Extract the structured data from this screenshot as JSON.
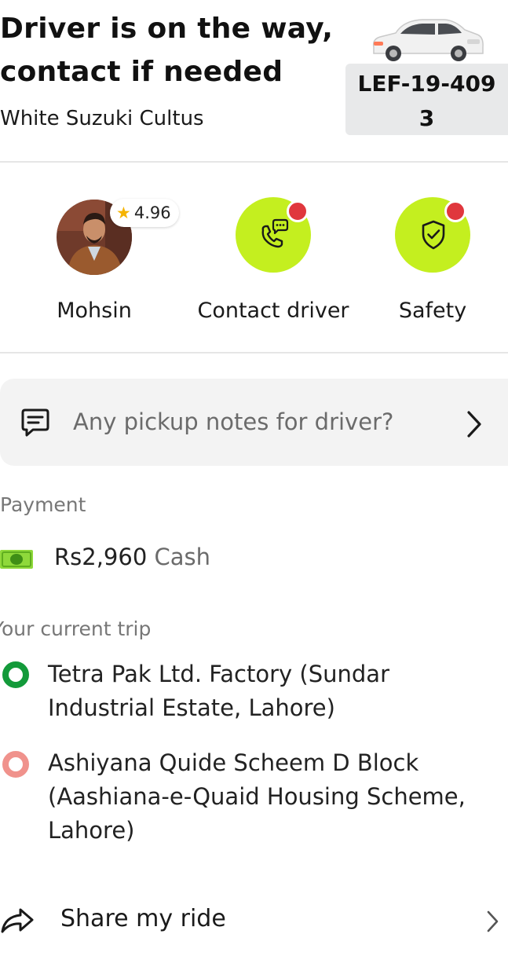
{
  "header": {
    "title_line1": "Driver is on the way,",
    "title_line2": "contact if needed",
    "vehicle": "White Suzuki Cultus",
    "plate_line1": "LEF-19-409",
    "plate_line2": "3",
    "icon": "car-icon"
  },
  "driver": {
    "name": "Mohsin",
    "rating": "4.96",
    "avatar_icon": "driver-avatar",
    "rating_icon": "star-icon"
  },
  "actions": [
    {
      "label": "Contact driver",
      "icon": "phone-chat-icon",
      "has_notification": true
    },
    {
      "label": "Safety",
      "icon": "shield-check-icon",
      "has_notification": true
    }
  ],
  "notes": {
    "placeholder": "Any pickup notes for driver?",
    "icon": "message-icon",
    "chevron_icon": "chevron-right-icon"
  },
  "payment": {
    "section_label": "Payment",
    "amount": "Rs2,960",
    "method": "Cash",
    "icon": "cash-icon"
  },
  "trip": {
    "section_label": "Your current trip",
    "pickup": {
      "line1": "Tetra Pak Ltd. Factory (Sundar",
      "line2": "Industrial Estate, Lahore)"
    },
    "dropoff": {
      "line1": "Ashiyana Quide Scheem D Block",
      "line2": "(Aashiana-e-Quaid Housing Scheme,",
      "line3": "Lahore)"
    }
  },
  "share": {
    "label": "Share my ride",
    "icon": "share-arrow-icon",
    "chevron_icon": "chevron-right-icon"
  },
  "colors": {
    "accent_green": "#c4ef1f",
    "notification_red": "#e0373d",
    "pickup_green": "#139a3a",
    "dropoff_salmon": "#f0928c"
  }
}
